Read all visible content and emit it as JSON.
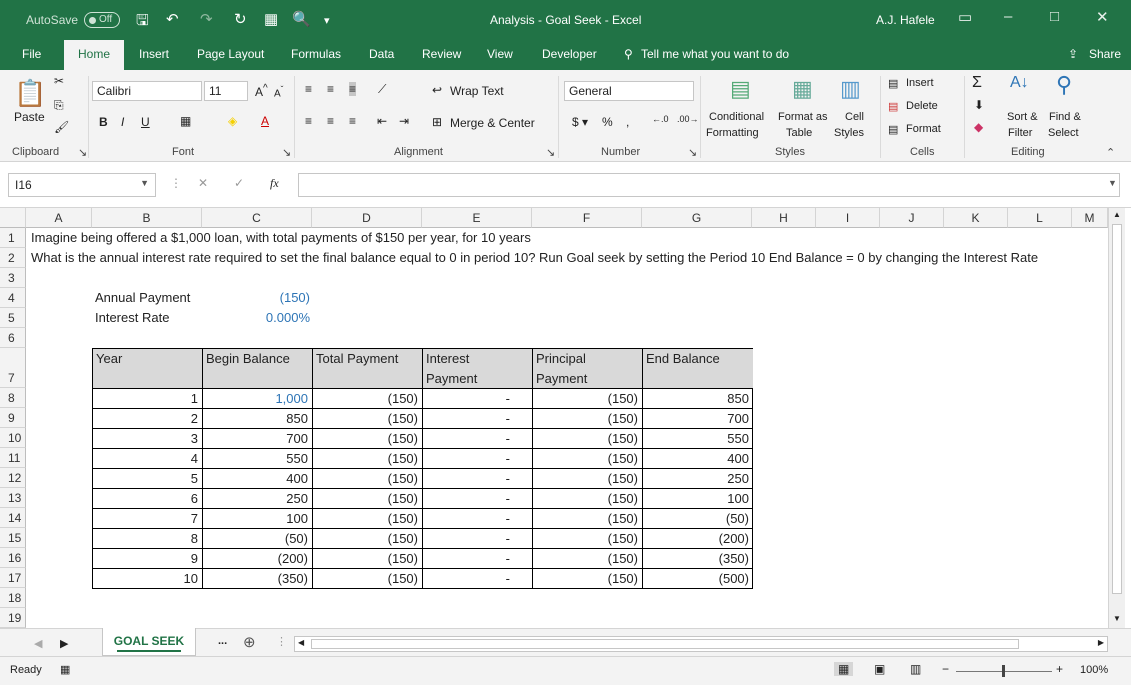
{
  "titlebar": {
    "autosave": "AutoSave",
    "autosave_state": "Off",
    "title": "Analysis - Goal Seek  -  Excel",
    "user": "A.J. Hafele"
  },
  "tabs": [
    "File",
    "Home",
    "Insert",
    "Page Layout",
    "Formulas",
    "Data",
    "Review",
    "View",
    "Developer"
  ],
  "tell_me": "Tell me what you want to do",
  "share": "Share",
  "ribbon": {
    "paste": "Paste",
    "font_name": "Calibri",
    "font_size": "11",
    "wrap_text": "Wrap Text",
    "merge_center": "Merge & Center",
    "number_format": "General",
    "conditional": "Conditional",
    "formatting": "Formatting",
    "format_as": "Format as",
    "table": "Table",
    "cell": "Cell",
    "styles_btn": "Styles",
    "insert": "Insert",
    "delete": "Delete",
    "format": "Format",
    "sort_filter_1": "Sort &",
    "sort_filter_2": "Filter",
    "find_select_1": "Find &",
    "find_select_2": "Select",
    "groups": {
      "clipboard": "Clipboard",
      "font": "Font",
      "alignment": "Alignment",
      "number": "Number",
      "styles": "Styles",
      "cells": "Cells",
      "editing": "Editing"
    }
  },
  "formula_bar": {
    "name_box": "I16",
    "formula": ""
  },
  "columns": [
    "A",
    "B",
    "C",
    "D",
    "E",
    "F",
    "G",
    "H",
    "I",
    "J",
    "K",
    "L",
    "M"
  ],
  "rows": [
    "1",
    "2",
    "3",
    "4",
    "5",
    "6",
    "7",
    "8",
    "9",
    "10",
    "11",
    "12",
    "13",
    "14",
    "15",
    "16",
    "17",
    "18",
    "19"
  ],
  "sheet": {
    "line1": "Imagine being offered a $1,000 loan, with total payments of $150 per year, for 10 years",
    "line2": "What is the annual interest rate required to set the final balance equal to 0 in period 10?  Run Goal seek by setting the Period 10 End Balance = 0 by changing the Interest Rate",
    "annual_payment_label": "Annual Payment",
    "annual_payment_value": "(150)",
    "interest_rate_label": "Interest Rate",
    "interest_rate_value": "0.000%"
  },
  "table": {
    "headers": [
      "Year",
      "Begin Balance",
      "Total Payment",
      "Interest\nPayment",
      "Principal\nPayment",
      "End Balance"
    ],
    "rows": [
      [
        "1",
        "1,000",
        "(150)",
        "-",
        "(150)",
        "850"
      ],
      [
        "2",
        "850",
        "(150)",
        "-",
        "(150)",
        "700"
      ],
      [
        "3",
        "700",
        "(150)",
        "-",
        "(150)",
        "550"
      ],
      [
        "4",
        "550",
        "(150)",
        "-",
        "(150)",
        "400"
      ],
      [
        "5",
        "400",
        "(150)",
        "-",
        "(150)",
        "250"
      ],
      [
        "6",
        "250",
        "(150)",
        "-",
        "(150)",
        "100"
      ],
      [
        "7",
        "100",
        "(150)",
        "-",
        "(150)",
        "(50)"
      ],
      [
        "8",
        "(50)",
        "(150)",
        "-",
        "(150)",
        "(200)"
      ],
      [
        "9",
        "(200)",
        "(150)",
        "-",
        "(150)",
        "(350)"
      ],
      [
        "10",
        "(350)",
        "(150)",
        "-",
        "(150)",
        "(500)"
      ]
    ]
  },
  "sheet_tab": "GOAL SEEK",
  "sheet_more": "...",
  "status": {
    "ready": "Ready",
    "zoom": "100%"
  },
  "colors": {
    "excel_green": "#217346",
    "input_blue": "#2e75b6",
    "header_gray": "#d9d9d9"
  }
}
